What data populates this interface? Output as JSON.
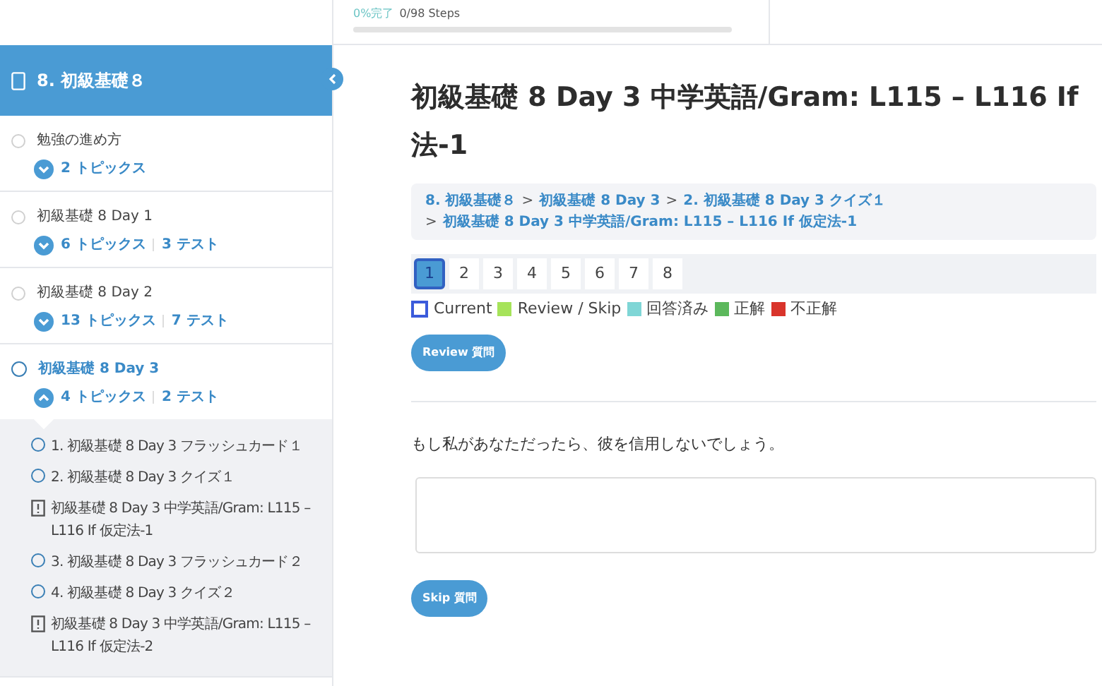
{
  "progress": {
    "percent": "0%完了",
    "steps": "0/98 Steps",
    "level": 0
  },
  "sidebar": {
    "title": "8. 初級基礎８",
    "lessons": [
      {
        "title": "勉強の進め方",
        "topics": "2 トピックス",
        "selected": false,
        "expanded": false
      },
      {
        "title": "初級基礎 8 Day 1",
        "topics": "6 トピックス",
        "tests": "3 テスト",
        "selected": false,
        "expanded": false
      },
      {
        "title": "初級基礎 8 Day 2",
        "topics": "13 トピックス",
        "tests": "7 テスト",
        "selected": false,
        "expanded": false
      },
      {
        "title": "初級基礎 8 Day 3",
        "topics": "4 トピックス",
        "tests": "2 テスト",
        "selected": true,
        "expanded": true,
        "children": [
          {
            "kind": "topic",
            "title": "1. 初級基礎 8 Day 3 フラッシュカード１"
          },
          {
            "kind": "topic",
            "title": "2. 初級基礎 8 Day 3 クイズ１"
          },
          {
            "kind": "quiz",
            "title": "初級基礎 8 Day 3 中学英語/Gram: L115 – L116 If 仮定法-1"
          },
          {
            "kind": "topic",
            "title": "3. 初級基礎 8 Day 3 フラッシュカード２"
          },
          {
            "kind": "topic",
            "title": "4. 初級基礎 8 Day 3 クイズ２"
          },
          {
            "kind": "quiz",
            "title": "初級基礎 8 Day 3 中学英語/Gram: L115 – L116 If 仮定法-2"
          }
        ]
      }
    ]
  },
  "title_lines": [
    "初級基礎 8 Day 3 中学英語/Gram: L115 – L116 If",
    "法-1"
  ],
  "breadcrumb_separator": ">",
  "breadcrumbs": [
    "8. 初級基礎８",
    "初級基礎 8 Day 3",
    "2. 初級基礎 8 Day 3 クイズ１",
    "初級基礎 8 Day 3 中学英語/Gram: L115 – L116 If 仮定法-1"
  ],
  "pages": [
    {
      "label": "1",
      "selected": true
    },
    {
      "label": "2",
      "selected": false
    },
    {
      "label": "3",
      "selected": false
    },
    {
      "label": "4",
      "selected": false
    },
    {
      "label": "5",
      "selected": false
    },
    {
      "label": "6",
      "selected": false
    },
    {
      "label": "7",
      "selected": false
    },
    {
      "label": "8",
      "selected": false
    }
  ],
  "legend": [
    {
      "label": "Current",
      "kind": "outline",
      "color": "#3b5bdb"
    },
    {
      "label": "Review / Skip",
      "kind": "fill",
      "color": "#a6e35a"
    },
    {
      "label": "回答済み",
      "kind": "fill",
      "color": "#7fd6d6"
    },
    {
      "label": "正解",
      "kind": "fill",
      "color": "#5cb85c"
    },
    {
      "label": "不正解",
      "kind": "fill",
      "color": "#d9342b"
    }
  ],
  "review_button": "Review 質問",
  "question": "もし私があなただったら、彼を信用しないでしょう。",
  "skip_button": "Skip 質問"
}
